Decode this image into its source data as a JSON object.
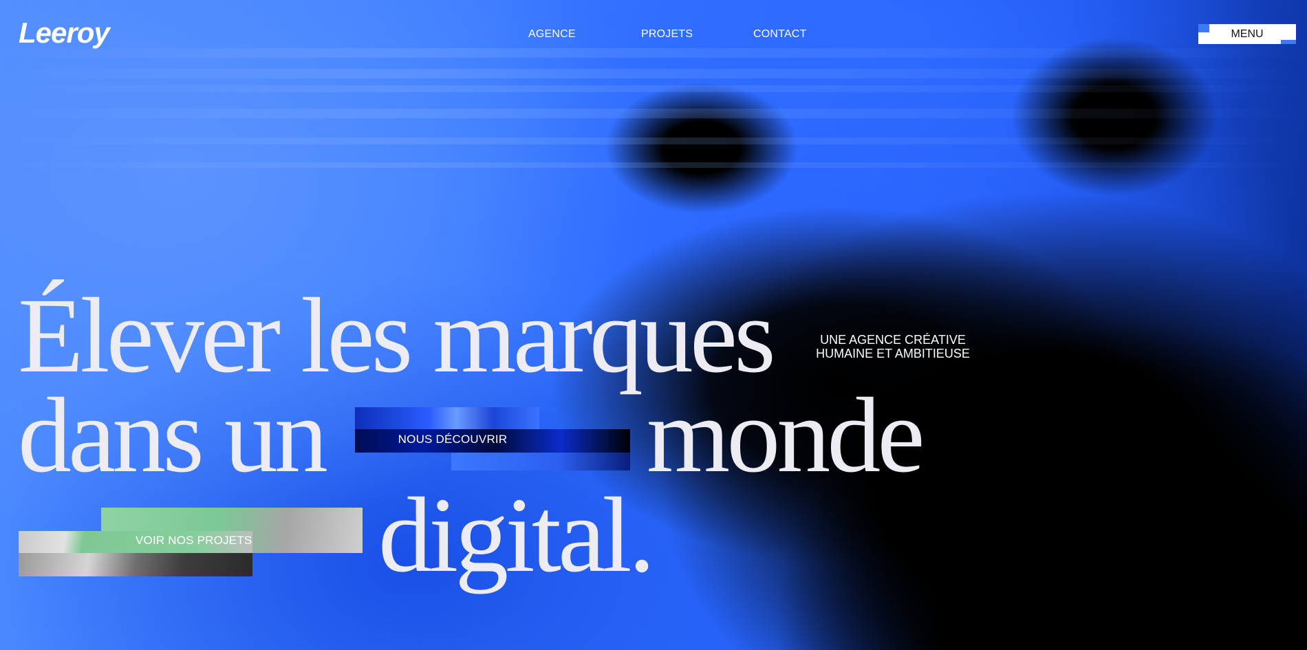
{
  "header": {
    "logo": "Leeroy",
    "nav": [
      "AGENCE",
      "PROJETS",
      "CONTACT"
    ],
    "menu_label": "MENU"
  },
  "hero": {
    "headline": {
      "line1": "Élever les marques",
      "line2a": "dans un",
      "line2b": "monde",
      "line3": "digital."
    },
    "tagline": [
      "UNE AGENCE CRÉATIVE",
      "HUMAINE ET AMBITIEUSE"
    ],
    "discover_button": "NOUS DÉCOUVRIR",
    "projects_button": "VOIR NOS PROJETS"
  },
  "colors": {
    "accent_blue": "#3a7bff",
    "text": "#ececf2",
    "menu_bg": "#ffffff"
  }
}
